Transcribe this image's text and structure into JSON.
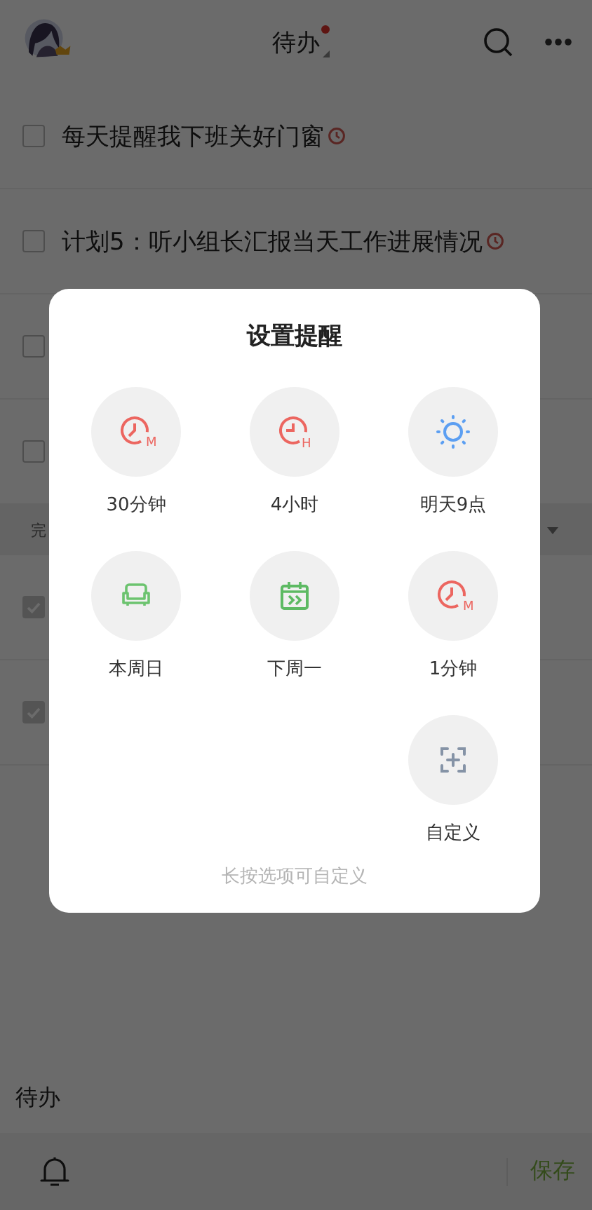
{
  "header": {
    "title": "待办",
    "unread": true
  },
  "todos": [
    {
      "text": "每天提醒我下班关好门窗",
      "checked": false,
      "reminder": true
    },
    {
      "text": "计划5：听小组长汇报当天工作进展情况",
      "checked": false,
      "reminder": true
    },
    {
      "checked": false
    },
    {
      "checked": false
    }
  ],
  "done_section": {
    "label": "完"
  },
  "done": [
    {
      "checked": true
    },
    {
      "checked": true
    }
  ],
  "editor": {
    "value": "待办",
    "save": "保存"
  },
  "dialog": {
    "title": "设置提醒",
    "options": [
      {
        "label": "30分钟",
        "kind": "clock",
        "icon_letter": "M"
      },
      {
        "label": "4小时",
        "kind": "clock-hour",
        "icon_letter": "H"
      },
      {
        "label": "明天9点",
        "kind": "sun"
      },
      {
        "label": "本周日",
        "kind": "sofa"
      },
      {
        "label": "下周一",
        "kind": "calendar"
      },
      {
        "label": "1分钟",
        "kind": "clock",
        "icon_letter": "M"
      },
      {
        "label": "自定义",
        "kind": "custom"
      }
    ],
    "hint": "长按选项可自定义"
  }
}
